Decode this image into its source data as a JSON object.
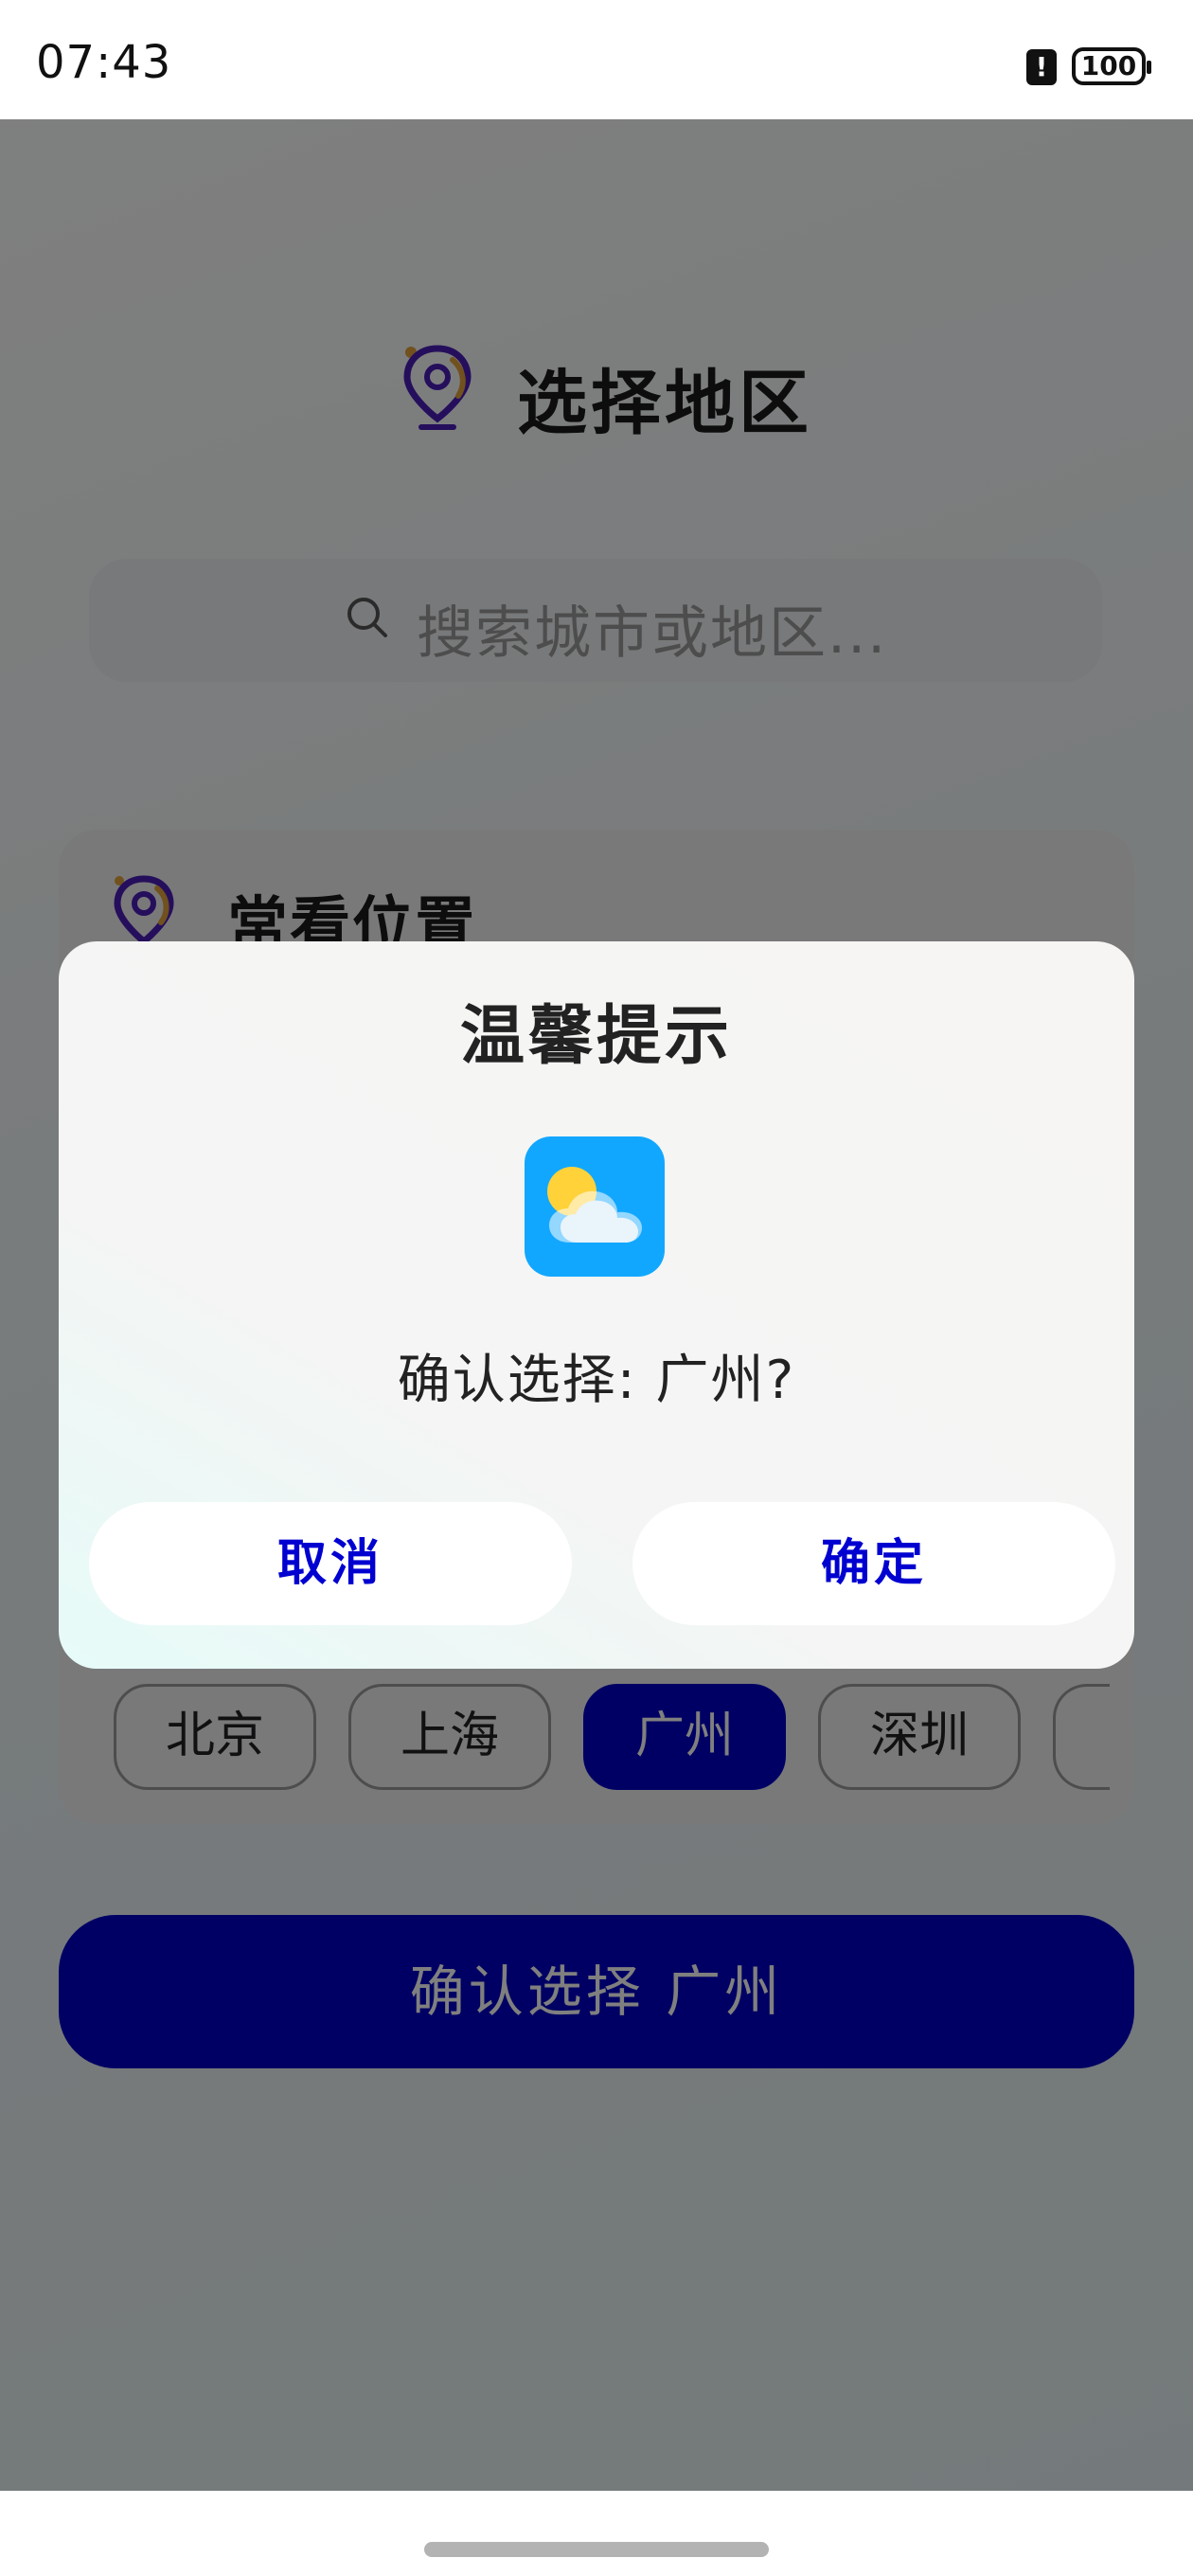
{
  "status_bar": {
    "time": "07:43",
    "alert_glyph": "!",
    "battery": "100"
  },
  "header": {
    "title": "选择地区",
    "icon": "location-pin-icon"
  },
  "search": {
    "placeholder": "搜索城市或地区..."
  },
  "recent": {
    "title": "常看位置",
    "cities": [
      "北京",
      "上海",
      "广州",
      "深圳"
    ],
    "selected": "广州"
  },
  "confirm_button": {
    "label": "确认选择 广州"
  },
  "dialog": {
    "title": "温馨提示",
    "icon": "weather-app-icon",
    "message": "确认选择: 广州?",
    "cancel_label": "取消",
    "ok_label": "确定"
  },
  "colors": {
    "accent": "#0000c8",
    "dialog_button_text": "#0000d0",
    "weather_icon_bg": "#12a7ff"
  }
}
